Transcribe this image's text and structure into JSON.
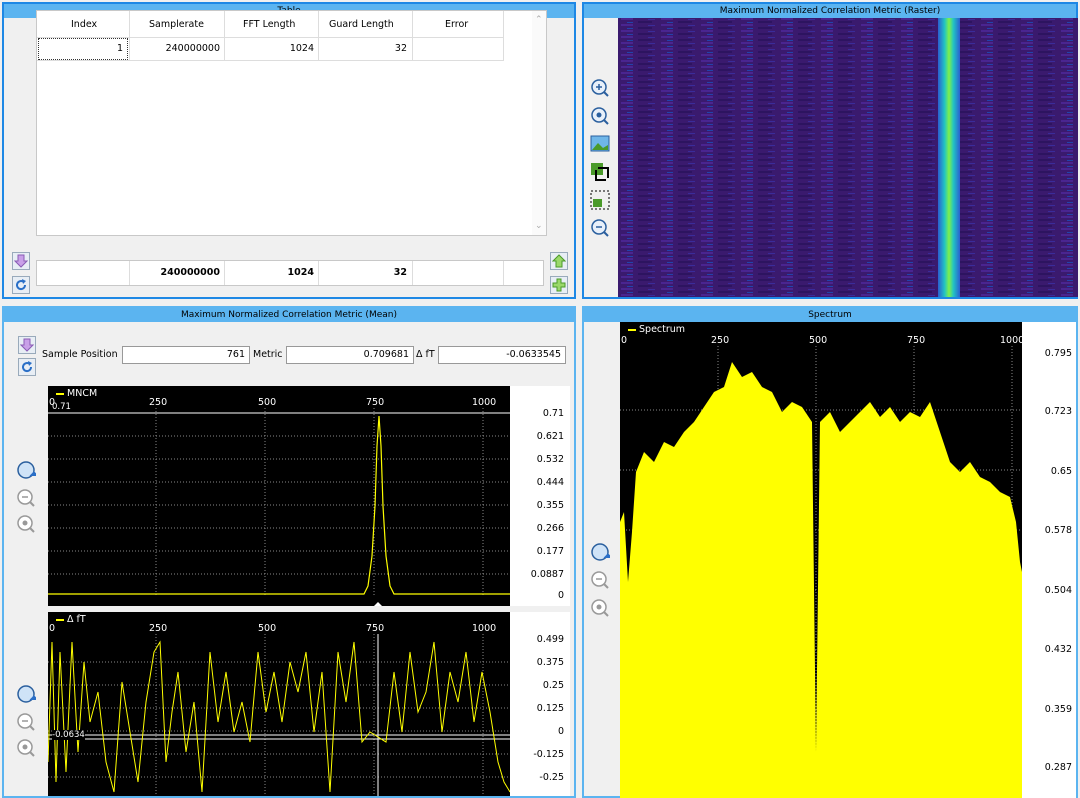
{
  "table_panel": {
    "title": "Table",
    "columns": [
      "Index",
      "Samplerate",
      "FFT Length",
      "Guard Length",
      "Error"
    ],
    "row": [
      "1",
      "240000000",
      "1024",
      "32",
      ""
    ],
    "footer": [
      "",
      "240000000",
      "1024",
      "32",
      ""
    ]
  },
  "raster_panel": {
    "title": "Maximum Normalized Correlation Metric (Raster)"
  },
  "mean_panel": {
    "title": "Maximum Normalized Correlation Metric (Mean)",
    "sample_position_label": "Sample Position",
    "sample_position_value": "761",
    "metric_label": "Metric",
    "metric_value": "0.709681",
    "dft_label": "Δ fT",
    "dft_value": "-0.0633545",
    "mncm_legend": "MNCM",
    "mncm_marker": "0.71",
    "dft_legend": "Δ fT",
    "dft_marker": "-0.0634",
    "x_ticks": [
      "0",
      "250",
      "500",
      "750",
      "1000"
    ],
    "mncm_y_ticks": [
      "0.71",
      "0.621",
      "0.532",
      "0.444",
      "0.355",
      "0.266",
      "0.177",
      "0.0887",
      "0"
    ],
    "dft_y_ticks": [
      "0.499",
      "0.375",
      "0.25",
      "0.125",
      "0",
      "-0.125",
      "-0.25"
    ]
  },
  "spectrum_panel": {
    "title": "Spectrum",
    "legend": "Spectrum",
    "x_ticks": [
      "0",
      "250",
      "500",
      "750",
      "1000"
    ],
    "y_ticks": [
      "0.795",
      "0.723",
      "0.65",
      "0.578",
      "0.504",
      "0.432",
      "0.359",
      "0.287"
    ]
  },
  "colors": {
    "accent": "#1e88e5",
    "title_bar": "#5bb4f0",
    "trace": "#ffff00",
    "plot_bg": "#000000"
  }
}
